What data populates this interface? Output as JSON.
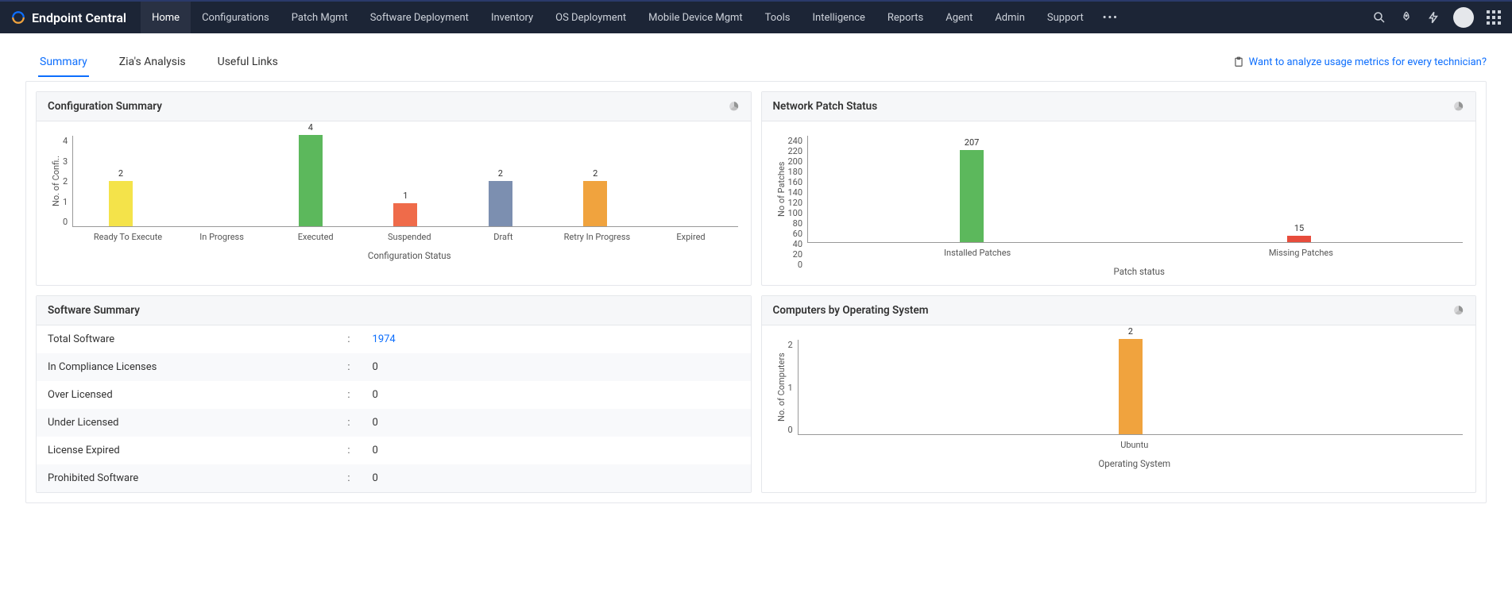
{
  "brand": "Endpoint Central",
  "nav": [
    "Home",
    "Configurations",
    "Patch Mgmt",
    "Software Deployment",
    "Inventory",
    "OS Deployment",
    "Mobile Device Mgmt",
    "Tools",
    "Intelligence",
    "Reports",
    "Agent",
    "Admin",
    "Support"
  ],
  "active_nav": 0,
  "tabs": [
    "Summary",
    "Zia's Analysis",
    "Useful Links"
  ],
  "active_tab": 0,
  "metrics_link": "Want to analyze usage metrics for every technician?",
  "panels": {
    "configSummary": {
      "title": "Configuration Summary"
    },
    "networkPatch": {
      "title": "Network Patch Status"
    },
    "softwareSummary": {
      "title": "Software Summary"
    },
    "computersOS": {
      "title": "Computers by Operating System"
    }
  },
  "softwareSummary": {
    "rows": [
      {
        "label": "Total Software",
        "value": "1974",
        "link": true
      },
      {
        "label": "In Compliance Licenses",
        "value": "0"
      },
      {
        "label": "Over Licensed",
        "value": "0"
      },
      {
        "label": "Under Licensed",
        "value": "0"
      },
      {
        "label": "License Expired",
        "value": "0"
      },
      {
        "label": "Prohibited Software",
        "value": "0"
      }
    ]
  },
  "chart_data": [
    {
      "id": "configSummary",
      "type": "bar",
      "categories": [
        "Ready To Execute",
        "In Progress",
        "Executed",
        "Suspended",
        "Draft",
        "Retry In Progress",
        "Expired"
      ],
      "values": [
        2,
        0,
        4,
        1,
        2,
        2,
        0
      ],
      "colors": [
        "#f4e34a",
        "#7cb5ec",
        "#5cb85c",
        "#ef6b4a",
        "#7c8fb0",
        "#f0a33e",
        "#9b59b6"
      ],
      "xlabel": "Configuration Status",
      "ylabel": "No. of Confi..",
      "ylim": [
        0,
        4
      ],
      "yticks": [
        0,
        1,
        2,
        3,
        4
      ]
    },
    {
      "id": "networkPatch",
      "type": "bar",
      "categories": [
        "Installed Patches",
        "Missing Patches"
      ],
      "values": [
        207,
        15
      ],
      "colors": [
        "#5cb85c",
        "#e74c3c"
      ],
      "xlabel": "Patch status",
      "ylabel": "No of Patches",
      "ylim": [
        0,
        240
      ],
      "yticks": [
        0,
        20,
        40,
        60,
        80,
        100,
        120,
        140,
        160,
        180,
        200,
        220,
        240
      ]
    },
    {
      "id": "computersOS",
      "type": "bar",
      "categories": [
        "Ubuntu"
      ],
      "values": [
        2
      ],
      "colors": [
        "#f0a33e"
      ],
      "xlabel": "Operating System",
      "ylabel": "No. of Computers",
      "ylim": [
        0,
        2
      ],
      "yticks": [
        0,
        1,
        2
      ]
    }
  ]
}
